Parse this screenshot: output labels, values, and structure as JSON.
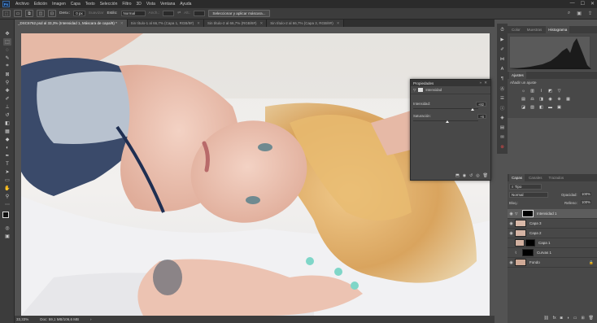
{
  "menu": {
    "items": [
      "Archivo",
      "Edición",
      "Imagen",
      "Capa",
      "Texto",
      "Selección",
      "Filtro",
      "3D",
      "Vista",
      "Ventana",
      "Ayuda"
    ],
    "logo": "Ps",
    "window_controls": [
      "—",
      "☐",
      "✕"
    ]
  },
  "options": {
    "feather_label": "Desv.:",
    "feather_value": "0 px",
    "smooth_label": "Suavizar",
    "style_label": "Estilo:",
    "style_value": "Normal",
    "width_label": "Anch.:",
    "height_label": "Alt.:",
    "select_mask_button": "Seleccionar y aplicar máscara..."
  },
  "tabs": [
    {
      "label": "_DSC6762.psd al 33,3% (Intensidad 1, Máscara de capa/8) *",
      "active": true
    },
    {
      "label": "Sin título-1 al 66,7% (Capa 1, RGB/8#)",
      "active": false
    },
    {
      "label": "Sin título-2 al 66,7% (RGB/8#)",
      "active": false
    },
    {
      "label": "Sin título-2 al 66,7% (Capa 3, RGB/8#)",
      "active": false
    }
  ],
  "status": {
    "zoom": "33,33%",
    "doc": "Doc: 59,1 MB/106,6 MB"
  },
  "properties": {
    "title": "Propiedades",
    "subtitle": "Intensidad",
    "vibrance_label": "Intensidad:",
    "vibrance_value": "+82",
    "vibrance_level": 0.91,
    "saturation_label": "Saturación:",
    "saturation_value": "+6",
    "saturation_level": 0.53
  },
  "right_top_tabs": [
    "Color",
    "Muestras",
    "Histograma"
  ],
  "adjust": {
    "tab": "Ajustes",
    "hint": "Añadir un ajuste"
  },
  "layers_tabs": [
    "Capas",
    "Canales",
    "Trazados"
  ],
  "layers": {
    "filter": "Tipo",
    "blend": "Normal",
    "opacity_label": "Opacidad:",
    "opacity_value": "100%",
    "lock_label": "Bloq.:",
    "fill_label": "Relleno:",
    "fill_value": "100%",
    "items": [
      {
        "name": "Intensidad 1",
        "selected": true
      },
      {
        "name": "Capa 3",
        "selected": false
      },
      {
        "name": "Capa 2",
        "selected": false
      },
      {
        "name": "Capa 1",
        "selected": false
      },
      {
        "name": "Curvas 1",
        "selected": false
      },
      {
        "name": "Fondo",
        "selected": false
      }
    ],
    "footer_icons": [
      "link-icon",
      "fx-icon",
      "mask-icon",
      "adjust-icon",
      "folder-icon",
      "new-layer-icon",
      "trash-icon"
    ]
  },
  "colors": {
    "accent": "#31a8ff",
    "panel": "#484848",
    "chrome": "#3c3c3c"
  }
}
